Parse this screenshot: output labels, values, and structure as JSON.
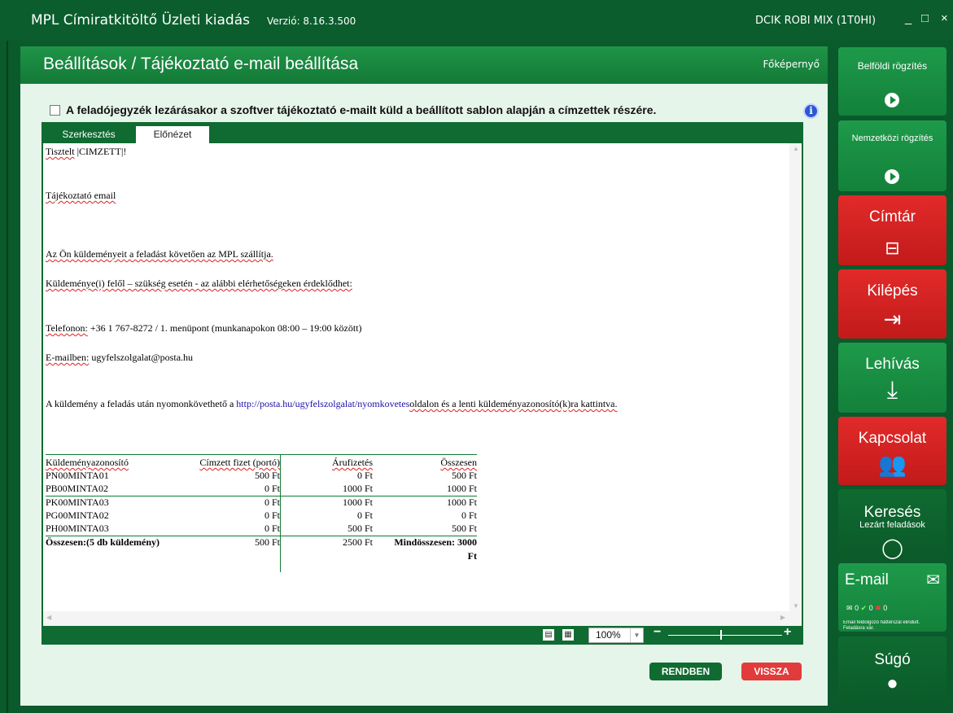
{
  "titlebar": {
    "app_title": "MPL Címiratkitöltő Üzleti kiadás",
    "version": "Verzió: 8.16.3.500",
    "user": "DCIK ROBI MIX (1T0HI)",
    "minimize": "_",
    "maximize": "□",
    "close": "×"
  },
  "panel": {
    "title": "Beállítások / Tájékoztató e-mail beállítása",
    "home_link": "Főképernyő",
    "checkbox_label": "A feladójegyzék lezárásakor a szoftver tájékoztató e-mailt küld a beállított sablon alapján a címzettek részére.",
    "info": "i"
  },
  "tabs": [
    {
      "label": "Szerkesztés",
      "active": false
    },
    {
      "label": "Előnézet",
      "active": true
    }
  ],
  "email": {
    "greeting_word": "Tisztelt",
    "greeting_rest": " |CIMZETT|!",
    "subject": "Tájékoztató email",
    "line1": "Az Ön küldeményeit a feladást követően az MPL szállítja.",
    "line2": "Küldeménye(i) felől – szükség esetén - az alábbi elérhetőségeken érdeklődhet:",
    "phone_label": "Telefonon:",
    "phone_text": " +36 1 767-8272 / 1. menüpont (munkanapokon 08:00 – 19:00 között)",
    "email_label": "E-mailben:",
    "email_text": " ugyfelszolgalat@posta.hu",
    "track_pre": "A küldemény a feladás után nyomonkövethető a ",
    "track_link": "http://posta.hu/ugyfelszolgalat/nyomkovetes",
    "track_post": "oldalon és a lenti küldeményazonosító(k)ra kattintva."
  },
  "table": {
    "headers": [
      "Küldeményazonosító",
      "Címzett fizet (portó)",
      "Árufizetés",
      "Összesen"
    ],
    "rows": [
      [
        "PN00MINTA01",
        "500 Ft",
        "0 Ft",
        "500 Ft"
      ],
      [
        "PB00MINTA02",
        "0 Ft",
        "1000 Ft",
        "1000 Ft"
      ],
      [
        "PK00MINTA03",
        "0 Ft",
        "1000 Ft",
        "1000 Ft"
      ],
      [
        "PG00MINTA02",
        "0 Ft",
        "0 Ft",
        "0 Ft"
      ],
      [
        "PH00MINTA03",
        "0 Ft",
        "500 Ft",
        "500 Ft"
      ]
    ],
    "total_label": "Összesen:(5 db küldemény)",
    "total_porto": "500 Ft",
    "total_aru": "2500 Ft",
    "grand_total_line1": "Mindösszesen: 3000",
    "grand_total_line2": "Ft"
  },
  "footer": {
    "zoom": "100%",
    "zoom_minus": "−",
    "zoom_plus": "+",
    "zoom_level_percent": 100
  },
  "buttons": {
    "ok": "RENDBEN",
    "back": "VISSZA"
  },
  "sidebar": {
    "domestic": "Belföldi rögzítés",
    "international": "Nemzetközi rögzítés",
    "directory": "Címtár",
    "exit": "Kilépés",
    "fetch": "Lehívás",
    "contact": "Kapcsolat",
    "search": "Keresés",
    "search_sub": "Lezárt feladások",
    "email": "E-mail",
    "email_counts": [
      "0",
      "0",
      "0"
    ],
    "email_note": "Email feldolgozó háttérszál elindult. Feladásra vár.",
    "help": "Súgó"
  },
  "colors": {
    "dark_green": "#0b5d2d",
    "green": "#13813a",
    "red": "#e22a2a",
    "panel_bg": "#e6f5ea"
  }
}
